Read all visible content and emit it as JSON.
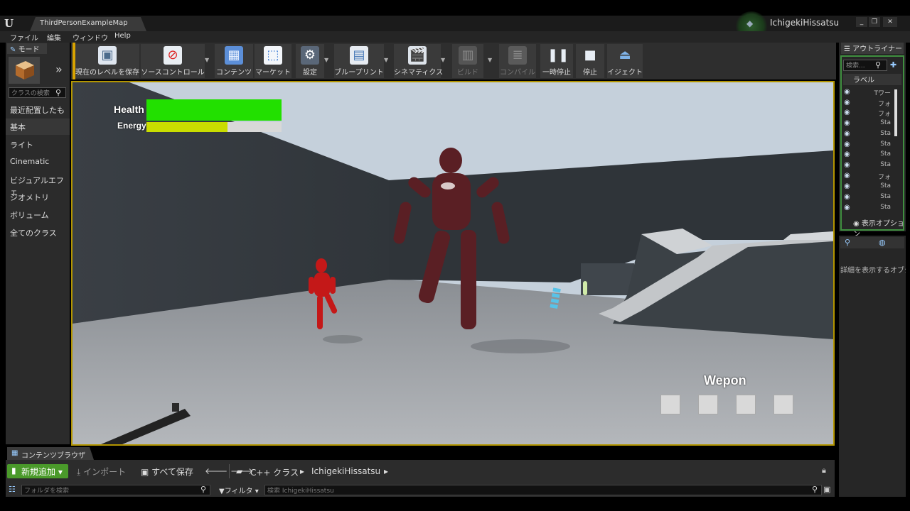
{
  "window": {
    "doc_tab": "ThirdPersonExampleMap",
    "user_name": "IchigekiHissatsu",
    "controls": [
      "_",
      "❐",
      "✕"
    ]
  },
  "menu": [
    "ファイル",
    "編集",
    "ウィンドウ",
    "Help"
  ],
  "modes": {
    "tab_label": "モード",
    "search_placeholder": "クラスの検索",
    "categories": [
      "最近配置したもの",
      "基本",
      "ライト",
      "Cinematic",
      "ビジュアルエフェ",
      "ジオメトリ",
      "ボリューム",
      "全てのクラス"
    ]
  },
  "toolbar": {
    "buttons": [
      {
        "label": "現在のレベルを保存",
        "icon": "save-icon"
      },
      {
        "label": "ソースコントロール",
        "icon": "source-control-icon"
      },
      {
        "label": "コンテンツ",
        "icon": "content-icon"
      },
      {
        "label": "マーケット",
        "icon": "marketplace-icon"
      },
      {
        "label": "設定",
        "icon": "settings-icon"
      },
      {
        "label": "ブループリント",
        "icon": "blueprint-icon"
      },
      {
        "label": "シネマティクス",
        "icon": "cinematics-icon"
      },
      {
        "label": "ビルド",
        "icon": "build-icon"
      },
      {
        "label": "コンパイル",
        "icon": "compile-icon"
      },
      {
        "label": "一時停止",
        "icon": "pause-icon"
      },
      {
        "label": "停止",
        "icon": "stop-icon"
      },
      {
        "label": "イジェクト",
        "icon": "eject-icon"
      }
    ]
  },
  "hud": {
    "health_label": "Health",
    "energy_label": "Energy",
    "health_fraction": 1.0,
    "energy_fraction": 0.6,
    "weapon_label": "Wepon",
    "weapon_slots": 4
  },
  "outliner": {
    "tab_label": "アウトライナー",
    "search_placeholder": "検索...",
    "column_label": "ラベル",
    "rows": [
      "Tワー",
      "フォ",
      "フォ",
      "Sta",
      "Sta",
      "Sta",
      "Sta",
      "Sta",
      "フォ",
      "Sta",
      "Sta",
      "Sta"
    ],
    "view_options": "表示オプション"
  },
  "details": {
    "empty_text": "詳細を表示するオブジェクトを選択してください"
  },
  "content_browser": {
    "tab_label": "コンテンツブラウザ",
    "new_button": "新規追加",
    "import_button": "インポート",
    "save_all_button": "すべて保存",
    "path": [
      "C++ クラス",
      "IchigekiHissatsu"
    ],
    "folder_search_placeholder": "フォルダを検索",
    "filter_label": "フィルタ",
    "asset_search_placeholder": "検索 IchigekiHissatsu"
  },
  "colors": {
    "health": "#22e000",
    "energy": "#c9dd00",
    "viewport_border": "#b39500",
    "new_button": "#4a9a2a"
  }
}
